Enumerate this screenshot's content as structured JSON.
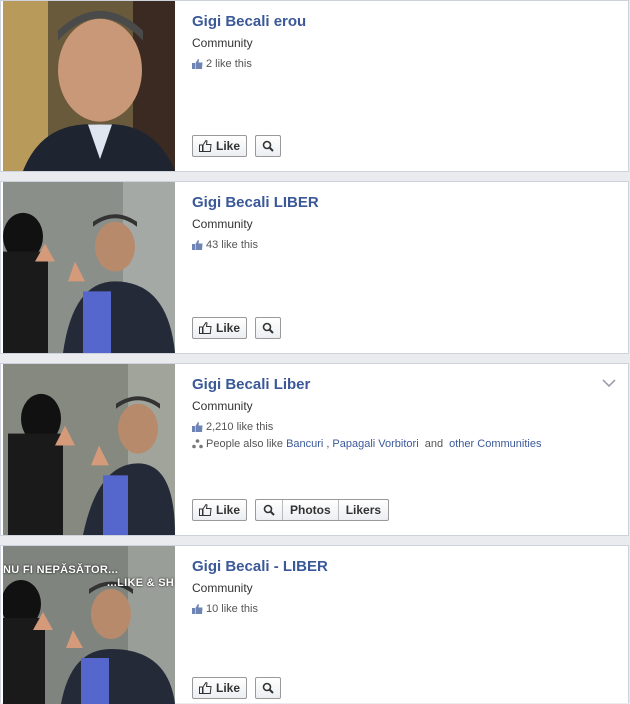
{
  "cards": [
    {
      "title": "Gigi Becali erou",
      "category": "Community",
      "likes": "2 like this",
      "actions": {
        "like": "Like"
      }
    },
    {
      "title": "Gigi Becali LIBER",
      "category": "Community",
      "likes": "43 like this",
      "actions": {
        "like": "Like"
      }
    },
    {
      "title": "Gigi Becali Liber",
      "category": "Community",
      "likes": "2,210 like this",
      "also_prefix": "People also like ",
      "also_link1": "Bancuri",
      "also_sep": ", ",
      "also_link2": "Papagali Vorbitori",
      "also_and": " and ",
      "also_link3": "other Communities",
      "actions": {
        "like": "Like",
        "photos": "Photos",
        "likers": "Likers"
      }
    },
    {
      "title": "Gigi Becali - LIBER",
      "category": "Community",
      "likes": "10 like this",
      "image_text_top": "NU FI NEPĂSĂTOR...",
      "image_text_bottom": "...LIKE & SH",
      "actions": {
        "like": "Like"
      }
    }
  ],
  "icons": {
    "like_count": "thumbs-up-icon",
    "like_button": "thumbs-up-outline-icon",
    "search": "magnifier-icon",
    "people": "people-icon",
    "chevron": "chevron-down-icon"
  },
  "colors": {
    "title": "#3b5998",
    "link": "#3b5998",
    "background": "#e9ebee",
    "border": "#cdd2dd"
  }
}
